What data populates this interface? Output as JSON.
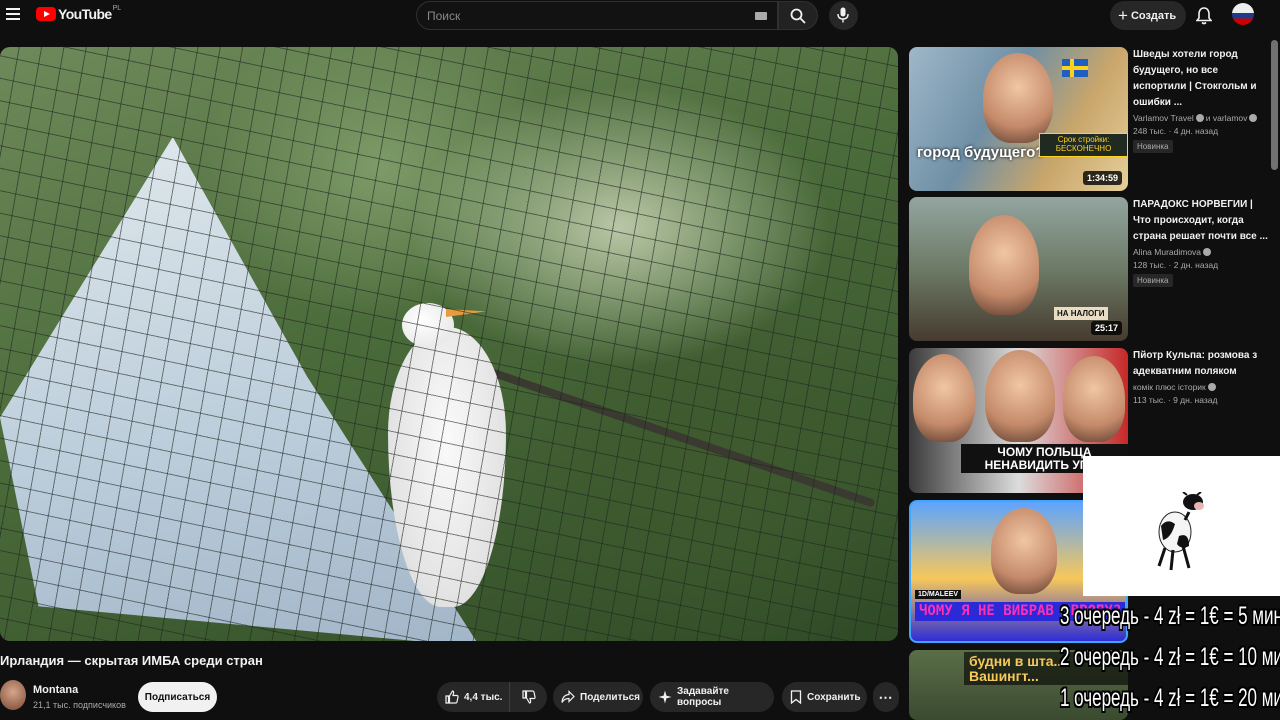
{
  "header": {
    "logo_text": "YouTube",
    "logo_country": "PL",
    "search_placeholder": "Поиск",
    "create_label": "Создать"
  },
  "video": {
    "title": "Ирландия — скрытая ИМБА среди стран",
    "channel_name": "Montana",
    "channel_subs": "21,1 тыс. подписчиков",
    "subscribe_label": "Подписаться",
    "likes": "4,4 тыс.",
    "share_label": "Поделиться",
    "ask_label": "Задавайте вопросы",
    "save_label": "Сохранить"
  },
  "recommendations": [
    {
      "title": "Шведы хотели город будущего, но все испортили | Стокгольм и ошибки ...",
      "channel": "Varlamov Travel",
      "channel_extra": "и varlamov",
      "meta": "248 тыс. · 4 дн. назад",
      "badge": "Новинка",
      "duration": "1:34:59",
      "thumb_text": "город будущего?",
      "thumb_badge": "Срок стройки: БЕСКОНЕЧНО"
    },
    {
      "title": "ПАРАДОКС НОРВЕГИИ | Что происходит, когда страна решает почти все ...",
      "channel": "Alina Muradimova",
      "meta": "128 тыс. · 2 дн. назад",
      "badge": "Новинка",
      "duration": "25:17",
      "thumb_tag": "НА НАЛОГИ"
    },
    {
      "title": "Пйотр Кульпа: розмова з адекватним поляком",
      "channel": "комік плюс історик",
      "meta": "113 тыс. · 9 дн. назад",
      "thumb_text": "ЧОМУ ПОЛЬЩА НЕНАВИДИТЬ УПА?"
    },
    {
      "thumb_text": "ЧОМУ Я НЕ ВИБРАВ ЄВРОПУ?",
      "thumb_caption": "1D/MALEEV"
    },
    {
      "thumb_text": "будни в шта... Вашингт..."
    }
  ],
  "overlay": {
    "lines": [
      "3 очередь - 4 zł = 1€ = 5 мин",
      "2 очередь - 4 zł = 1€ = 10 мин",
      "1 очередь - 4 zł = 1€ = 20 мин"
    ]
  }
}
